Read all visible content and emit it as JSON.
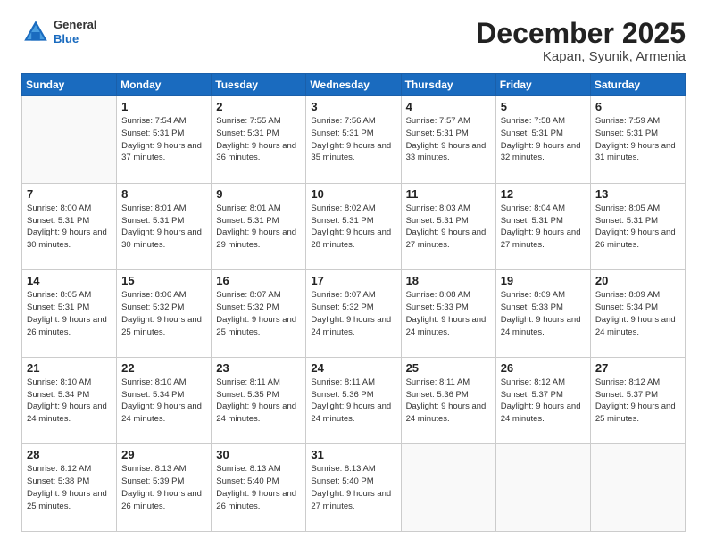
{
  "header": {
    "logo": {
      "general": "General",
      "blue": "Blue"
    },
    "month": "December 2025",
    "location": "Kapan, Syunik, Armenia"
  },
  "weekdays": [
    "Sunday",
    "Monday",
    "Tuesday",
    "Wednesday",
    "Thursday",
    "Friday",
    "Saturday"
  ],
  "weeks": [
    [
      {
        "day": "",
        "info": ""
      },
      {
        "day": "1",
        "info": "Sunrise: 7:54 AM\nSunset: 5:31 PM\nDaylight: 9 hours\nand 37 minutes."
      },
      {
        "day": "2",
        "info": "Sunrise: 7:55 AM\nSunset: 5:31 PM\nDaylight: 9 hours\nand 36 minutes."
      },
      {
        "day": "3",
        "info": "Sunrise: 7:56 AM\nSunset: 5:31 PM\nDaylight: 9 hours\nand 35 minutes."
      },
      {
        "day": "4",
        "info": "Sunrise: 7:57 AM\nSunset: 5:31 PM\nDaylight: 9 hours\nand 33 minutes."
      },
      {
        "day": "5",
        "info": "Sunrise: 7:58 AM\nSunset: 5:31 PM\nDaylight: 9 hours\nand 32 minutes."
      },
      {
        "day": "6",
        "info": "Sunrise: 7:59 AM\nSunset: 5:31 PM\nDaylight: 9 hours\nand 31 minutes."
      }
    ],
    [
      {
        "day": "7",
        "info": "Sunrise: 8:00 AM\nSunset: 5:31 PM\nDaylight: 9 hours\nand 30 minutes."
      },
      {
        "day": "8",
        "info": "Sunrise: 8:01 AM\nSunset: 5:31 PM\nDaylight: 9 hours\nand 30 minutes."
      },
      {
        "day": "9",
        "info": "Sunrise: 8:01 AM\nSunset: 5:31 PM\nDaylight: 9 hours\nand 29 minutes."
      },
      {
        "day": "10",
        "info": "Sunrise: 8:02 AM\nSunset: 5:31 PM\nDaylight: 9 hours\nand 28 minutes."
      },
      {
        "day": "11",
        "info": "Sunrise: 8:03 AM\nSunset: 5:31 PM\nDaylight: 9 hours\nand 27 minutes."
      },
      {
        "day": "12",
        "info": "Sunrise: 8:04 AM\nSunset: 5:31 PM\nDaylight: 9 hours\nand 27 minutes."
      },
      {
        "day": "13",
        "info": "Sunrise: 8:05 AM\nSunset: 5:31 PM\nDaylight: 9 hours\nand 26 minutes."
      }
    ],
    [
      {
        "day": "14",
        "info": "Sunrise: 8:05 AM\nSunset: 5:31 PM\nDaylight: 9 hours\nand 26 minutes."
      },
      {
        "day": "15",
        "info": "Sunrise: 8:06 AM\nSunset: 5:32 PM\nDaylight: 9 hours\nand 25 minutes."
      },
      {
        "day": "16",
        "info": "Sunrise: 8:07 AM\nSunset: 5:32 PM\nDaylight: 9 hours\nand 25 minutes."
      },
      {
        "day": "17",
        "info": "Sunrise: 8:07 AM\nSunset: 5:32 PM\nDaylight: 9 hours\nand 24 minutes."
      },
      {
        "day": "18",
        "info": "Sunrise: 8:08 AM\nSunset: 5:33 PM\nDaylight: 9 hours\nand 24 minutes."
      },
      {
        "day": "19",
        "info": "Sunrise: 8:09 AM\nSunset: 5:33 PM\nDaylight: 9 hours\nand 24 minutes."
      },
      {
        "day": "20",
        "info": "Sunrise: 8:09 AM\nSunset: 5:34 PM\nDaylight: 9 hours\nand 24 minutes."
      }
    ],
    [
      {
        "day": "21",
        "info": "Sunrise: 8:10 AM\nSunset: 5:34 PM\nDaylight: 9 hours\nand 24 minutes."
      },
      {
        "day": "22",
        "info": "Sunrise: 8:10 AM\nSunset: 5:34 PM\nDaylight: 9 hours\nand 24 minutes."
      },
      {
        "day": "23",
        "info": "Sunrise: 8:11 AM\nSunset: 5:35 PM\nDaylight: 9 hours\nand 24 minutes."
      },
      {
        "day": "24",
        "info": "Sunrise: 8:11 AM\nSunset: 5:36 PM\nDaylight: 9 hours\nand 24 minutes."
      },
      {
        "day": "25",
        "info": "Sunrise: 8:11 AM\nSunset: 5:36 PM\nDaylight: 9 hours\nand 24 minutes."
      },
      {
        "day": "26",
        "info": "Sunrise: 8:12 AM\nSunset: 5:37 PM\nDaylight: 9 hours\nand 24 minutes."
      },
      {
        "day": "27",
        "info": "Sunrise: 8:12 AM\nSunset: 5:37 PM\nDaylight: 9 hours\nand 25 minutes."
      }
    ],
    [
      {
        "day": "28",
        "info": "Sunrise: 8:12 AM\nSunset: 5:38 PM\nDaylight: 9 hours\nand 25 minutes."
      },
      {
        "day": "29",
        "info": "Sunrise: 8:13 AM\nSunset: 5:39 PM\nDaylight: 9 hours\nand 26 minutes."
      },
      {
        "day": "30",
        "info": "Sunrise: 8:13 AM\nSunset: 5:40 PM\nDaylight: 9 hours\nand 26 minutes."
      },
      {
        "day": "31",
        "info": "Sunrise: 8:13 AM\nSunset: 5:40 PM\nDaylight: 9 hours\nand 27 minutes."
      },
      {
        "day": "",
        "info": ""
      },
      {
        "day": "",
        "info": ""
      },
      {
        "day": "",
        "info": ""
      }
    ]
  ]
}
